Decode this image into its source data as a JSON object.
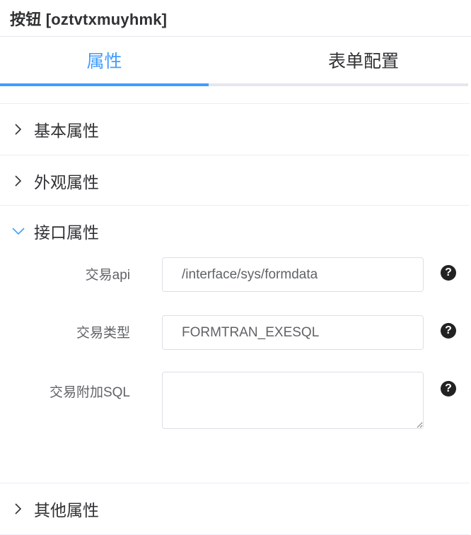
{
  "panel": {
    "title": "按钮 [oztvtxmuyhmk]"
  },
  "tabs": [
    {
      "label": "属性",
      "active": true
    },
    {
      "label": "表单配置",
      "active": false
    }
  ],
  "sections": {
    "basic": {
      "label": "基本属性",
      "expanded": false
    },
    "appearance": {
      "label": "外观属性",
      "expanded": false
    },
    "interface": {
      "label": "接口属性",
      "expanded": true
    },
    "other": {
      "label": "其他属性",
      "expanded": false
    }
  },
  "interface_fields": {
    "api": {
      "label": "交易api",
      "value": "/interface/sys/formdata"
    },
    "type": {
      "label": "交易类型",
      "value": "FORMTRAN_EXESQL"
    },
    "sql": {
      "label": "交易附加SQL",
      "value": ""
    }
  },
  "icons": {
    "collapsed": "chevron-right-icon",
    "expanded": "chevron-down-icon",
    "help": "question-circle-icon"
  },
  "colors": {
    "accent": "#409eff",
    "text": "#303133",
    "muted": "#606266",
    "border": "#dcdfe6"
  }
}
